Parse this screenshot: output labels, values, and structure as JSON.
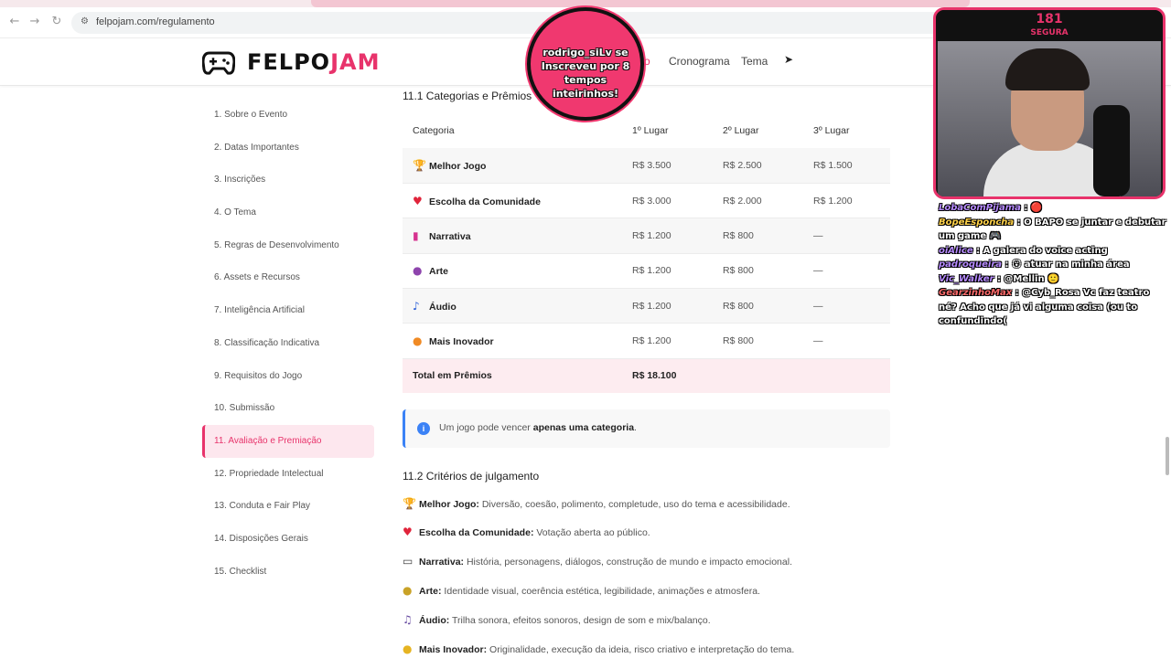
{
  "browser": {
    "url": "felpojam.com/regulamento",
    "back_icon": "arrow-left-icon",
    "forward_icon": "arrow-right-icon",
    "reload_icon": "reload-icon"
  },
  "header": {
    "logo_felpo": "FELPO",
    "logo_jam": "JAM",
    "nav": [
      "o",
      "Cronograma",
      "Tema"
    ]
  },
  "sidebar": {
    "items": [
      "1. Sobre o Evento",
      "2. Datas Importantes",
      "3. Inscrições",
      "4. O Tema",
      "5. Regras de Desenvolvimento",
      "6. Assets e Recursos",
      "7. Inteligência Artificial",
      "8. Classificação Indicativa",
      "9. Requisitos do Jogo",
      "10. Submissão",
      "11. Avaliação e Premiação",
      "12. Propriedade Intelectual",
      "13. Conduta e Fair Play",
      "14. Disposições Gerais",
      "15. Checklist"
    ],
    "active_index": 10
  },
  "section_11_1": {
    "title": "11.1 Categorias e Prêmios",
    "columns": [
      "Categoria",
      "1º Lugar",
      "2º Lugar",
      "3º Lugar"
    ],
    "rows": [
      {
        "icon": "trophy-icon",
        "category": "Melhor Jogo",
        "first": "R$ 3.500",
        "second": "R$ 2.500",
        "third": "R$ 1.500"
      },
      {
        "icon": "heart-icon",
        "category": "Escolha da Comunidade",
        "first": "R$ 3.000",
        "second": "R$ 2.000",
        "third": "R$ 1.200"
      },
      {
        "icon": "book-icon",
        "category": "Narrativa",
        "first": "R$ 1.200",
        "second": "R$ 800",
        "third": "—"
      },
      {
        "icon": "palette-icon",
        "category": "Arte",
        "first": "R$ 1.200",
        "second": "R$ 800",
        "third": "—"
      },
      {
        "icon": "music-note-icon",
        "category": "Áudio",
        "first": "R$ 1.200",
        "second": "R$ 800",
        "third": "—"
      },
      {
        "icon": "lightbulb-icon",
        "category": "Mais Inovador",
        "first": "R$ 1.200",
        "second": "R$ 800",
        "third": "—"
      }
    ],
    "total_label": "Total em Prêmios",
    "total_value": "R$ 18.100"
  },
  "info": {
    "text_before": "Um jogo pode vencer ",
    "text_bold": "apenas uma categoria",
    "text_after": "."
  },
  "section_11_2": {
    "title": "11.2 Critérios de julgamento",
    "criteria": [
      {
        "icon": "trophy-icon",
        "label": "Melhor Jogo:",
        "text": " Diversão, coesão, polimento, completude, uso do tema e acessibilidade."
      },
      {
        "icon": "heart-icon",
        "label": "Escolha da Comunidade:",
        "text": " Votação aberta ao público."
      },
      {
        "icon": "book-icon",
        "label": "Narrativa:",
        "text": " História, personagens, diálogos, construção de mundo e impacto emocional."
      },
      {
        "icon": "palette-icon",
        "label": "Arte:",
        "text": " Identidade visual, coerência estética, legibilidade, animações e atmosfera."
      },
      {
        "icon": "music-note-icon",
        "label": "Áudio:",
        "text": " Trilha sonora, efeitos sonoros, design de som e mix/balanço."
      },
      {
        "icon": "lightbulb-icon",
        "label": "Mais Inovador:",
        "text": " Originalidade, execução da ideia, risco criativo e interpretação do tema."
      }
    ]
  },
  "stream": {
    "alert": "rodrigo_siLv se Inscreveu por 8 tempos inteirinhos!",
    "counter": "181",
    "counter_label": "SEGURA",
    "chat": [
      {
        "user": "LobaComPijama",
        "message": " : 🔴"
      },
      {
        "user": "BopeEsponcha",
        "message": " : O BAPO se juntar e debutar um game 🎮"
      },
      {
        "user": "oiAlice",
        "message": " : A galera do voice acting"
      },
      {
        "user": "padroqueira",
        "message": " : 😮 atuar na minha área"
      },
      {
        "user": "Vic_Walker",
        "message": " : @Mellin 🙂"
      },
      {
        "user": "GearzinhoMax",
        "message": " : @Cyb_Rosa Vc faz teatro né? Acho que já vi alguma coisa (ou to confundindo("
      }
    ]
  },
  "colors": {
    "accent": "#e8336b",
    "info_blue": "#3b82f6"
  }
}
